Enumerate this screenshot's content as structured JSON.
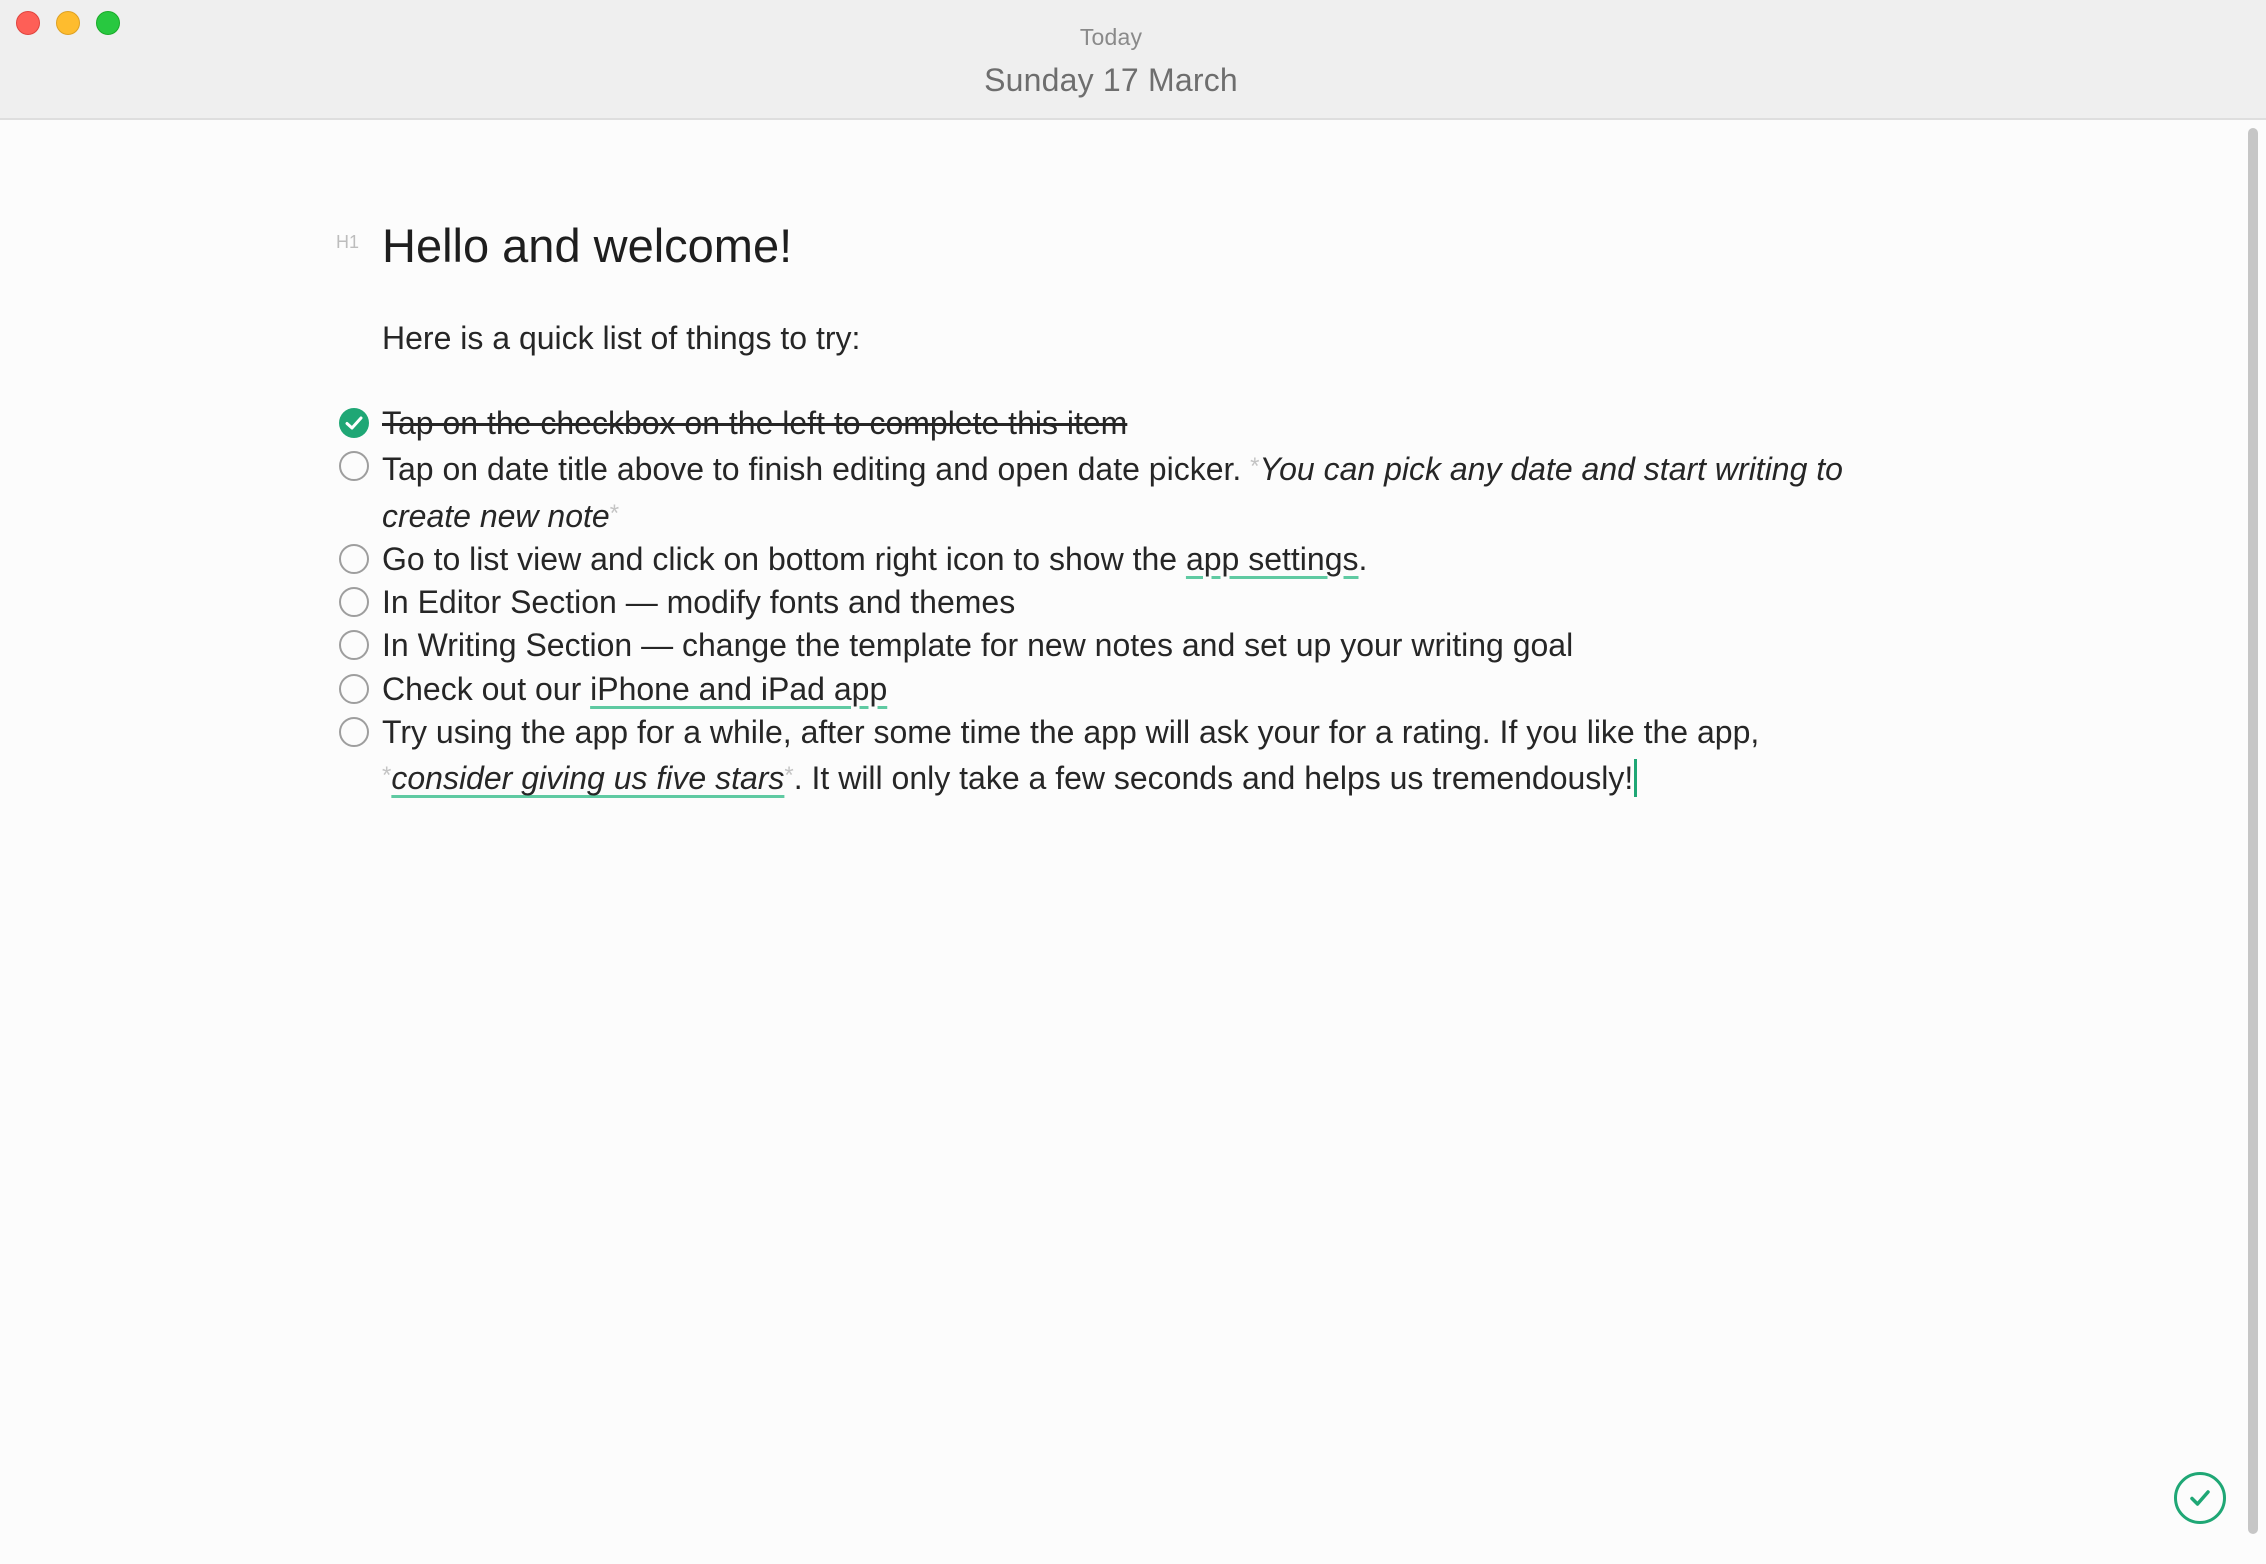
{
  "window": {
    "controls": [
      "close",
      "minimize",
      "maximize"
    ]
  },
  "header": {
    "subtitle": "Today",
    "date_title": "Sunday 17 March"
  },
  "editor": {
    "heading_marker": "H1",
    "heading": "Hello and welcome!",
    "intro": "Here is a quick list of things to try:",
    "todos": [
      {
        "checked": true,
        "text": "Tap on the checkbox on the left to complete this item"
      },
      {
        "checked": false,
        "text": "Tap on date title above to finish editing and open date picker.",
        "emphasis_line1": "You can pick any date and start writing to",
        "emphasis_line2": "create new note",
        "md_mark": "*"
      },
      {
        "checked": false,
        "text_before": "Go to list view and click on bottom right icon to show the ",
        "link": "app settings",
        "text_after": "."
      },
      {
        "checked": false,
        "text": "In Editor Section — modify fonts and themes"
      },
      {
        "checked": false,
        "text": "In Writing Section — change the template for new notes and set up your writing goal"
      },
      {
        "checked": false,
        "text_before": "Check out our ",
        "link": "iPhone and iPad app"
      },
      {
        "checked": false,
        "text_line1": "Try using the app for a while, after some time the app will ask your for a rating. If you like the app,",
        "md_mark": "*",
        "link": "consider giving us five stars",
        "text_after": ". It will only take a few seconds and helps us tremendously!"
      }
    ]
  },
  "colors": {
    "accent": "#1fa775",
    "link_underline": "#5fcaa2",
    "titlebar": "#efefef",
    "background": "#fcfcfc"
  },
  "icons": {
    "done_button": "checkmark-circle-icon"
  }
}
